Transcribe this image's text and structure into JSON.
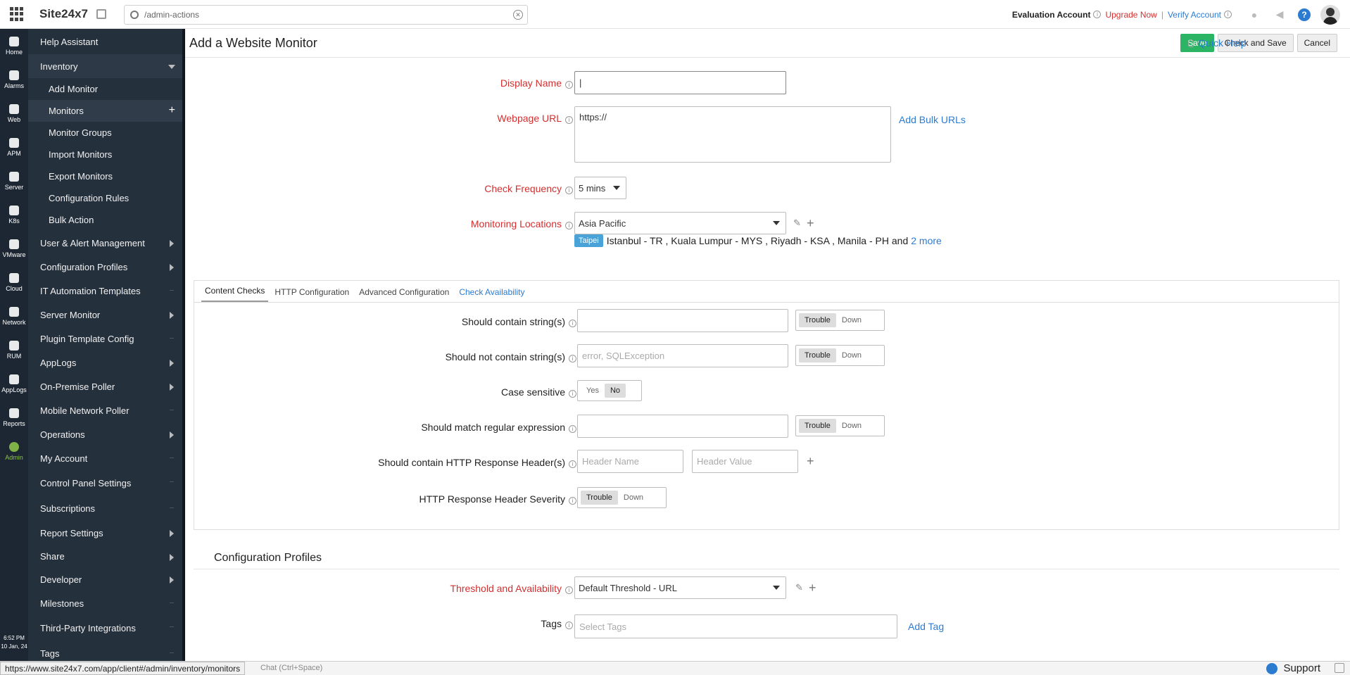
{
  "topbar": {
    "logo": "Site24x7",
    "search_value": "/admin-actions",
    "eval_label": "Evaluation Account",
    "upgrade_label": "Upgrade Now",
    "separator": "|",
    "verify_label": "Verify Account"
  },
  "rail": {
    "items": [
      "Home",
      "Alarms",
      "Web",
      "APM",
      "Server",
      "K8s",
      "VMware",
      "Cloud",
      "Network",
      "RUM",
      "AppLogs",
      "Reports",
      "Admin"
    ],
    "time": "6:52 PM",
    "date": "10 Jan, 24"
  },
  "sidebar": {
    "items": [
      "Help Assistant",
      "Inventory",
      "Add Monitor",
      "Monitors",
      "Monitor Groups",
      "Import Monitors",
      "Export Monitors",
      "Configuration Rules",
      "Bulk Action",
      "User & Alert Management",
      "Configuration Profiles",
      "IT Automation Templates",
      "Server Monitor",
      "Plugin Template Config",
      "AppLogs",
      "On-Premise Poller",
      "Mobile Network Poller",
      "Operations",
      "My Account",
      "Control Panel Settings",
      "Subscriptions",
      "Report Settings",
      "Share",
      "Developer",
      "Milestones",
      "Third-Party Integrations",
      "Tags"
    ]
  },
  "header": {
    "title": "Add a Website Monitor",
    "save": "Save",
    "check_save": "Check and Save",
    "cancel": "Cancel",
    "quick_help": "Quick Help"
  },
  "form": {
    "display_name_label": "Display Name",
    "display_name_value": "|",
    "webpage_url_label": "Webpage URL",
    "webpage_url_value": "https://",
    "add_bulk_urls": "Add Bulk URLs",
    "check_frequency_label": "Check Frequency",
    "check_frequency_value": "5 mins",
    "monitoring_locations_label": "Monitoring Locations",
    "monitoring_locations_value": "Asia Pacific",
    "location_chip": "Taipei",
    "locations_text": "Istanbul - TR , Kuala Lumpur - MYS , Riyadh - KSA , Manila - PH and",
    "locations_more": "2 more"
  },
  "tabs": [
    "Content Checks",
    "HTTP Configuration",
    "Advanced Configuration",
    "Check Availability"
  ],
  "content_checks": {
    "contain_label": "Should contain string(s)",
    "not_contain_label": "Should not contain string(s)",
    "not_contain_placeholder": "error, SQLException",
    "case_label": "Case sensitive",
    "regex_label": "Should match regular expression",
    "header_label": "Should contain HTTP Response Header(s)",
    "header_name_placeholder": "Header Name",
    "header_value_placeholder": "Header Value",
    "severity_label": "HTTP Response Header Severity",
    "trouble": "Trouble",
    "down": "Down",
    "yes": "Yes",
    "no": "No"
  },
  "config_profiles": {
    "title": "Configuration Profiles",
    "threshold_label": "Threshold and Availability",
    "threshold_value": "Default Threshold - URL",
    "tags_label": "Tags",
    "tags_placeholder": "Select Tags",
    "add_tag": "Add Tag"
  },
  "statusbar": {
    "url": "https://www.site24x7.com/app/client#/admin/inventory/monitors",
    "chat_hint": "Chat (Ctrl+Space)",
    "support": "Support"
  }
}
